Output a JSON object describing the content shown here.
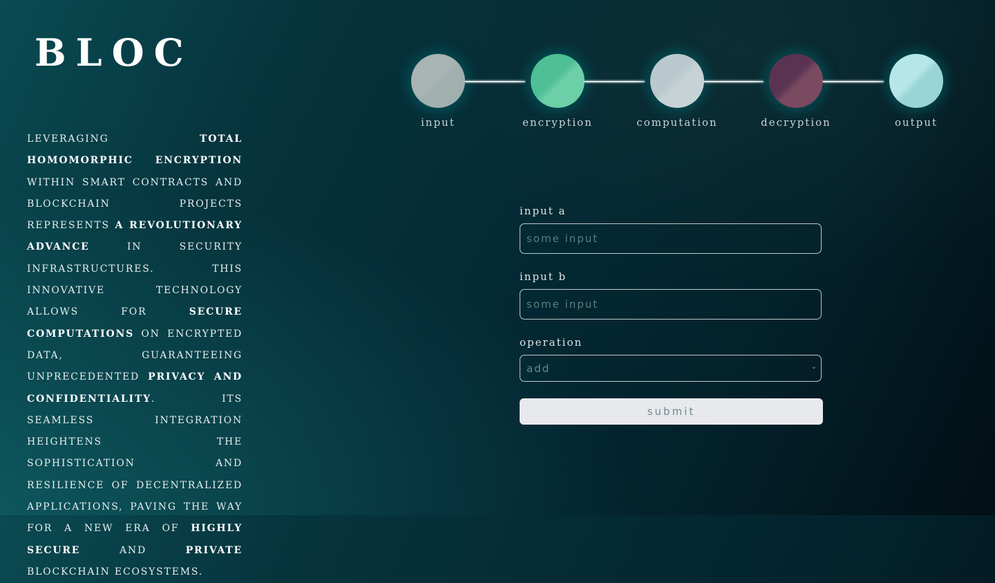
{
  "brand": {
    "logo": "BLOC"
  },
  "description": [
    {
      "text": "Leveraging ",
      "bold": false
    },
    {
      "text": "total homomorphic encryption",
      "bold": true
    },
    {
      "text": " within smart contracts and blockchain projects represents ",
      "bold": false
    },
    {
      "text": "a revolutionary advance",
      "bold": true
    },
    {
      "text": " in security infrastructures. This innovative technology allows for ",
      "bold": false
    },
    {
      "text": "secure computations",
      "bold": true
    },
    {
      "text": " on encrypted data, guaranteeing unprecedented ",
      "bold": false
    },
    {
      "text": "privacy and confidentiality",
      "bold": true
    },
    {
      "text": ". Its seamless integration heightens the sophistication and resilience of decentralized applications, paving the way for a new era of ",
      "bold": false
    },
    {
      "text": "highly secure",
      "bold": true
    },
    {
      "text": " and ",
      "bold": false
    },
    {
      "text": "private",
      "bold": true
    },
    {
      "text": " blockchain ecosystems.",
      "bold": false
    }
  ],
  "pipeline": [
    {
      "label": "input",
      "color_a": "#a9b4b3",
      "color_b": "#9fb0ae"
    },
    {
      "label": "encryption",
      "color_a": "#4fbf95",
      "color_b": "#6ccfa8"
    },
    {
      "label": "computation",
      "color_a": "#b9c9cd",
      "color_b": "#c6d2d6"
    },
    {
      "label": "decryption",
      "color_a": "#5a3352",
      "color_b": "#7a4a60"
    },
    {
      "label": "output",
      "color_a": "#b5e6e8",
      "color_b": "#99d4d6"
    }
  ],
  "form": {
    "input_a": {
      "label": "input a",
      "placeholder": "some input",
      "value": ""
    },
    "input_b": {
      "label": "input b",
      "placeholder": "some input",
      "value": ""
    },
    "operation": {
      "label": "operation",
      "selected": "add"
    },
    "submit_label": "submit"
  }
}
